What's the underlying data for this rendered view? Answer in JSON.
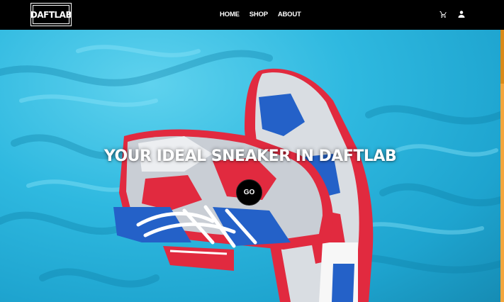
{
  "brand": {
    "logo_text": "DAFTLAB"
  },
  "nav": {
    "items": [
      "HOME",
      "SHOP",
      "ABOUT"
    ]
  },
  "header_icons": {
    "cart": "cart-icon",
    "user": "user-icon"
  },
  "hero": {
    "headline": "YOUR IDEAL SNEAKER IN DAFTLAB",
    "cta_label": "GO",
    "image": "sneakers-on-blue-fabric"
  },
  "colors": {
    "header_bg": "#000000",
    "fabric_blue": "#2fb9e0",
    "shoe_red": "#e01f3d",
    "shoe_blue": "#1f5fc9",
    "scrollbar": "#f3a63d"
  }
}
